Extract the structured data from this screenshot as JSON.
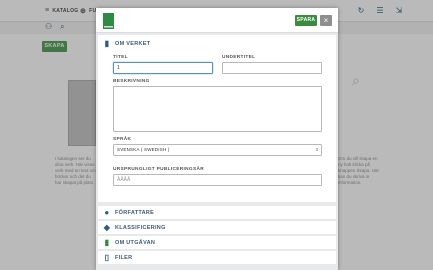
{
  "background": {
    "nav": [
      {
        "icon": "menu-icon",
        "label": "KATALOG"
      },
      {
        "icon": "plus-circle-icon",
        "label": "FUNK"
      }
    ],
    "right_icons": [
      "refresh-icon",
      "database-icon",
      "export-icon"
    ],
    "create_button": "SKAPA",
    "left_text": "I katalogen ser du dina verk. Här visas verk med en text om böcker och det du har skapat på plats.",
    "right_text": "Om du vill skapa en ny bok klicka på knappen Skapa. Här kan du skriva in information."
  },
  "modal": {
    "save_button": "SPARA",
    "close_icon": "×",
    "sections": {
      "about_work": {
        "title": "OM VERKET",
        "title_label": "TITEL",
        "title_value": "1",
        "subtitle_label": "UNDERTITEL",
        "subtitle_value": "",
        "description_label": "BESKRIVNING",
        "description_value": "",
        "language_label": "SPRÅK",
        "language_value": "SVENSKA ( SWEDISH )",
        "year_label": "URSPRUNGLIGT PUBLICERINGSÅR",
        "year_placeholder": "ÅÅÅÅ"
      },
      "authors": {
        "title": "FÖRFATTARE",
        "icon": "person-icon"
      },
      "classification": {
        "title": "KLASSIFICERING",
        "icon": "tags-icon"
      },
      "about_edition": {
        "title": "OM UTGÅVAN",
        "icon": "book-icon"
      },
      "files": {
        "title": "FILER",
        "icon": "file-icon"
      }
    }
  },
  "colors": {
    "accent_green": "#3b8c3e",
    "section_title": "#3c5b77"
  }
}
